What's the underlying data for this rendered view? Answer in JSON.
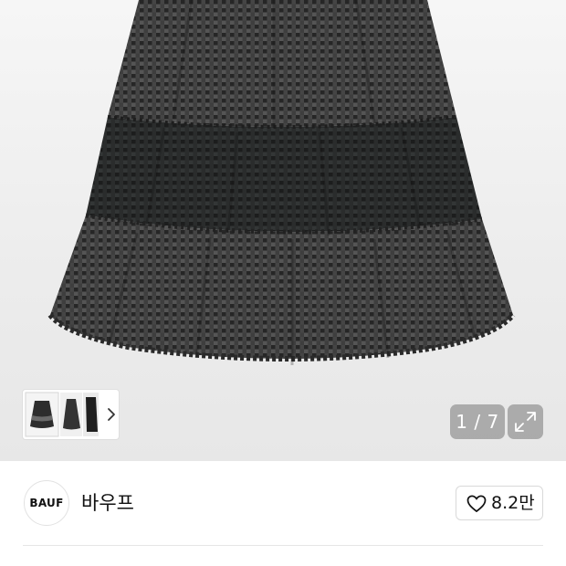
{
  "gallery": {
    "current_index": "1",
    "total": "7",
    "counter_text": "1 / 7",
    "thumbnail_icons": [
      "skirt-thumbnail",
      "skirt-side-thumbnail",
      "skirt-detail-thumbnail"
    ],
    "next_icon": "chevron-right-icon",
    "expand_icon": "expand-icon"
  },
  "brand": {
    "logo_text": "BAUF",
    "name": "바우프"
  },
  "like": {
    "icon": "heart-outline-icon",
    "count": "8.2만"
  },
  "colors": {
    "hero_bg": "#ececec",
    "fabric_dark": "#2b2b2b",
    "fabric_light": "#5a5a5a",
    "overlay": "#7a7a7a"
  }
}
